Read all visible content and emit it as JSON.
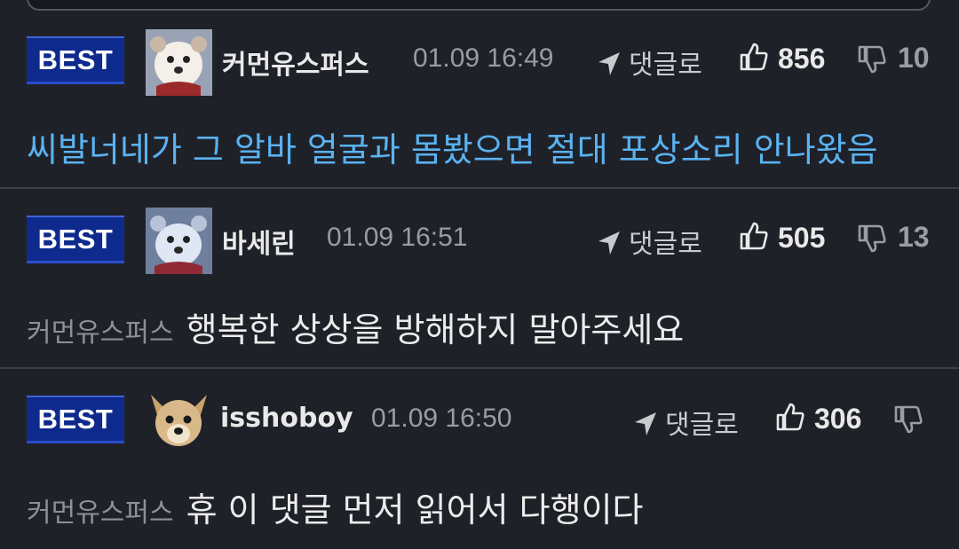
{
  "comments": [
    {
      "badge": "BEST",
      "username": "커먼유스퍼스",
      "time": "01.09 16:49",
      "reply_label": "댓글로",
      "likes": "856",
      "dislikes": "10",
      "mention": "",
      "text": "씨발너네가 그 알바 얼굴과 몸봤으면 절대 포상소리 안나왔음",
      "text_color": "#5ab2f0"
    },
    {
      "badge": "BEST",
      "username": "바세린",
      "time": "01.09 16:51",
      "reply_label": "댓글로",
      "likes": "505",
      "dislikes": "13",
      "mention": "커먼유스퍼스",
      "text": "행복한 상상을 방해하지 말아주세요",
      "text_color": "#ececec"
    },
    {
      "badge": "BEST",
      "username": "isshoboy",
      "time": "01.09 16:50",
      "reply_label": "댓글로",
      "likes": "306",
      "dislikes": "",
      "mention": "커먼유스퍼스",
      "text": "휴 이 댓글 먼저 읽어서 다행이다",
      "text_color": "#ececec"
    }
  ],
  "colors": {
    "background": "#1f2129",
    "badge": "#0e2a8c",
    "highlight_text": "#5ab2f0"
  },
  "icons": {
    "reply": "navigation-arrow-icon",
    "like": "thumbs-up-icon",
    "dislike": "thumbs-down-icon"
  }
}
